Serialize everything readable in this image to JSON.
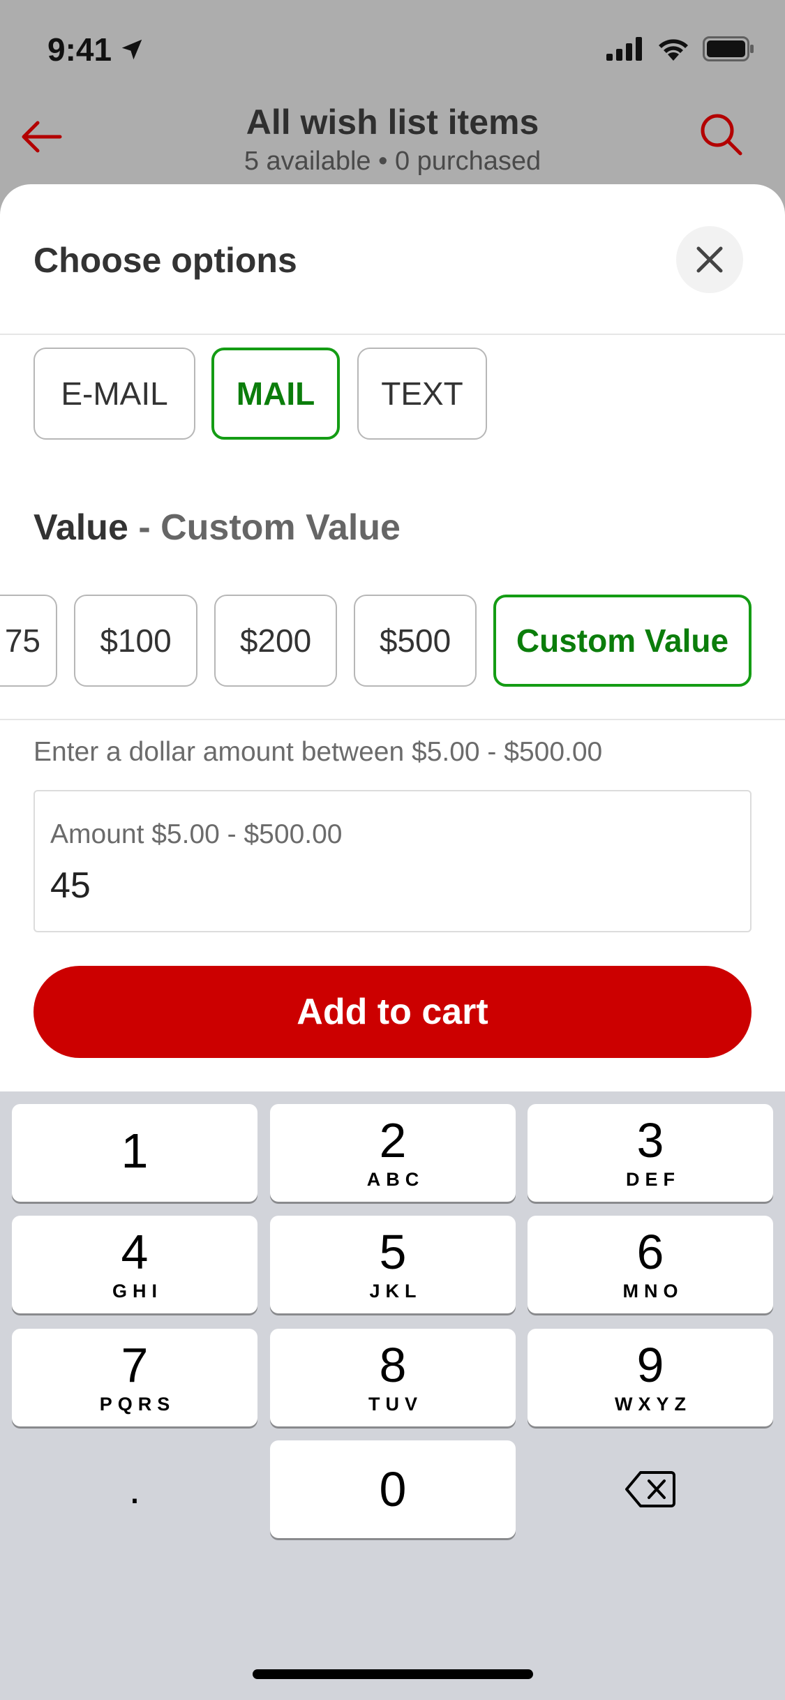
{
  "status_bar": {
    "time": "9:41",
    "icons": [
      "location-arrow-icon",
      "cellular-signal-icon",
      "wifi-icon",
      "battery-icon"
    ]
  },
  "header": {
    "title": "All wish list items",
    "subtitle": "5 available • 0 purchased",
    "back_icon": "arrow-left-icon",
    "search_icon": "search-icon"
  },
  "sheet": {
    "title": "Choose options",
    "close_icon": "close-icon",
    "delivery_options": [
      {
        "label": "E-MAIL",
        "selected": false
      },
      {
        "label": "MAIL",
        "selected": true
      },
      {
        "label": "TEXT",
        "selected": false
      }
    ],
    "value_section": {
      "label": "Value",
      "separator": " - ",
      "selected_label": "Custom Value"
    },
    "value_options": [
      {
        "label": "75",
        "selected": false
      },
      {
        "label": "$100",
        "selected": false
      },
      {
        "label": "$200",
        "selected": false
      },
      {
        "label": "$500",
        "selected": false
      },
      {
        "label": "Custom Value",
        "selected": true
      }
    ],
    "hint": "Enter a dollar amount between $5.00 - $500.00",
    "amount_field": {
      "label": "Amount $5.00 - $500.00",
      "value": "45"
    },
    "add_to_cart_label": "Add to cart"
  },
  "keyboard": {
    "keys": [
      {
        "digit": "1",
        "letters": ""
      },
      {
        "digit": "2",
        "letters": "ABC"
      },
      {
        "digit": "3",
        "letters": "DEF"
      },
      {
        "digit": "4",
        "letters": "GHI"
      },
      {
        "digit": "5",
        "letters": "JKL"
      },
      {
        "digit": "6",
        "letters": "MNO"
      },
      {
        "digit": "7",
        "letters": "PQRS"
      },
      {
        "digit": "8",
        "letters": "TUV"
      },
      {
        "digit": "9",
        "letters": "WXYZ"
      },
      {
        "digit": ".",
        "letters": ""
      },
      {
        "digit": "0",
        "letters": ""
      }
    ],
    "delete_icon": "backspace-icon"
  },
  "colors": {
    "accent_red": "#cc0000",
    "selected_green": "#149c14",
    "keyboard_bg": "#d2d4da"
  }
}
